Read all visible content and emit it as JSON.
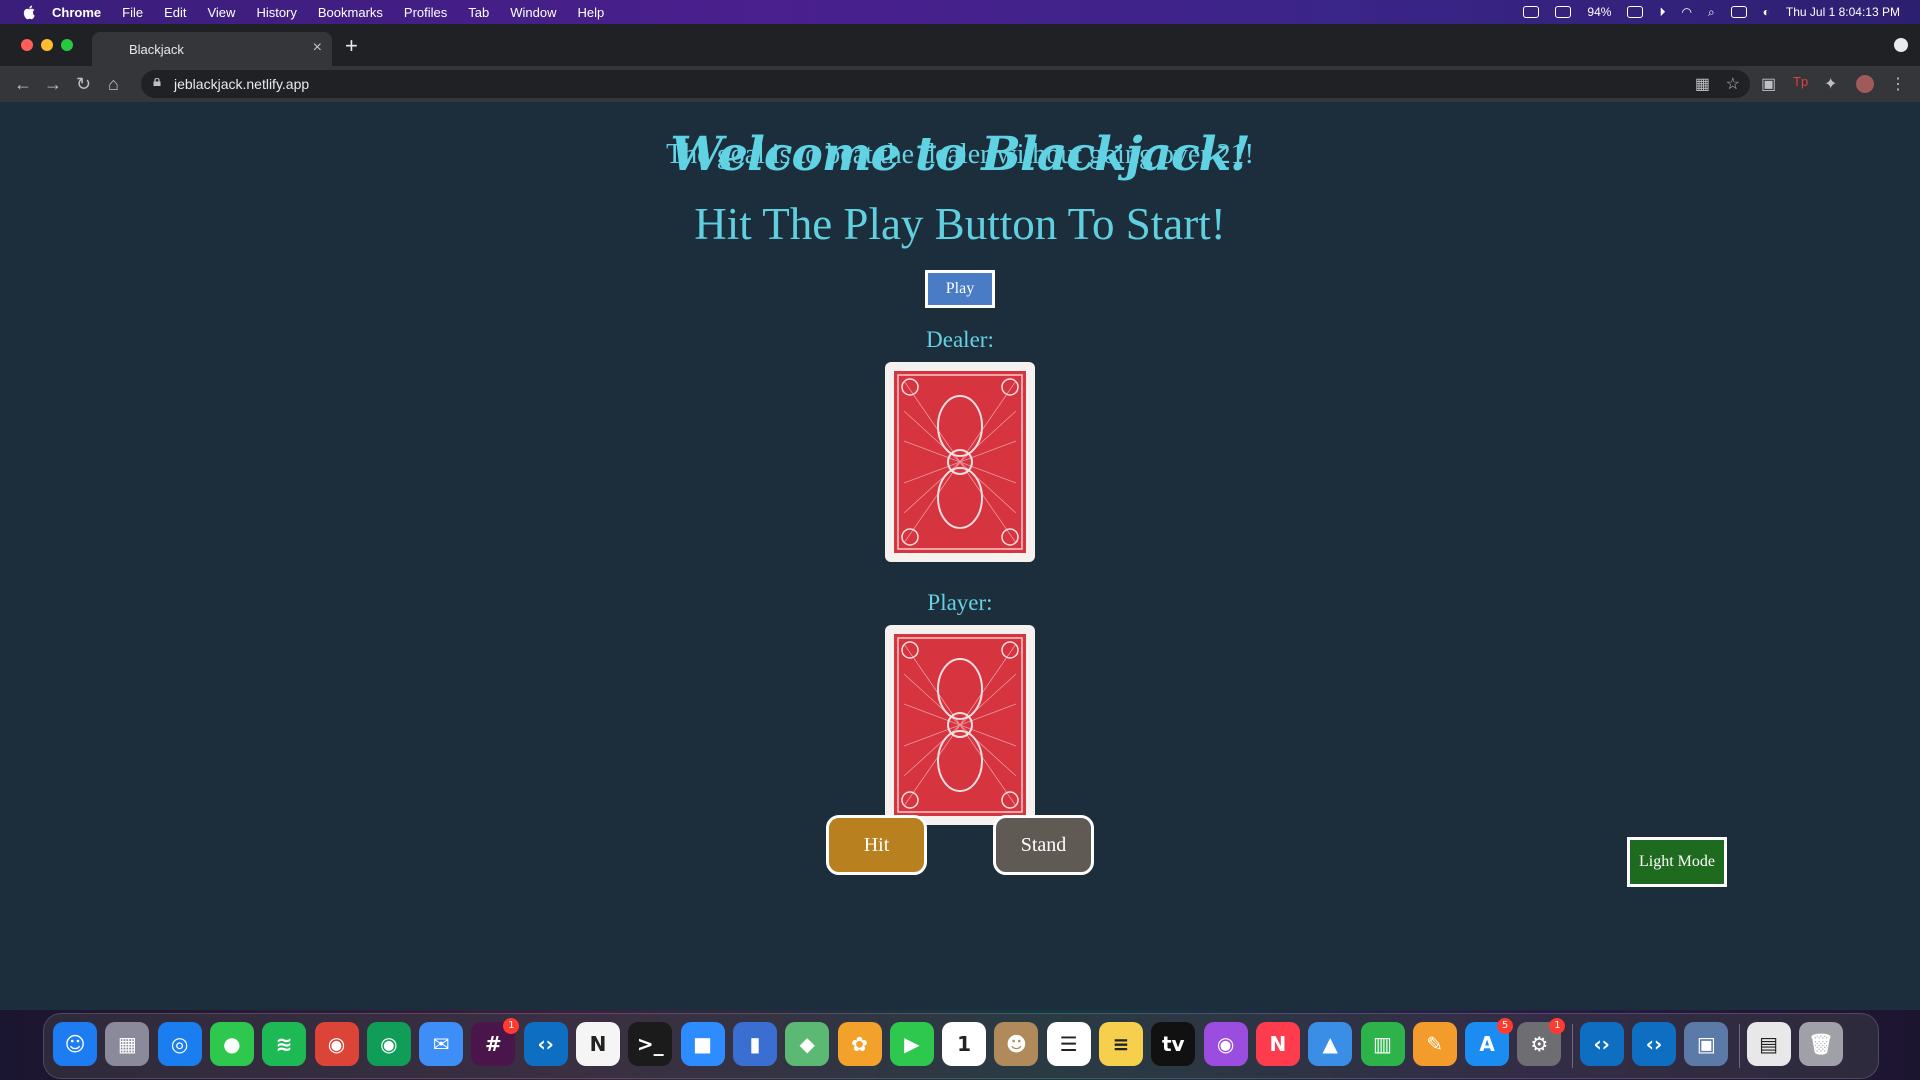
{
  "menubar": {
    "items": [
      "Chrome",
      "File",
      "Edit",
      "View",
      "History",
      "Bookmarks",
      "Profiles",
      "Tab",
      "Window",
      "Help"
    ],
    "battery": "94%",
    "datetime": "Thu Jul 1  8:04:13 PM"
  },
  "browser": {
    "tab_title": "Blackjack",
    "url": "jeblackjack.netlify.app"
  },
  "page": {
    "title": "Welcome to Blackjack!",
    "subtitle": "The goal is to beat the dealer without going over 21!",
    "instruction": "Hit The Play Button To Start!",
    "play_label": "Play",
    "dealer_label": "Dealer:",
    "player_label": "Player:",
    "hit_label": "Hit",
    "stand_label": "Stand",
    "light_mode_label": "Light Mode"
  },
  "colors": {
    "page_bg": "#1c2e3c",
    "heading": "#5fd3e3",
    "play_button": "#4a7cc6",
    "hit_button": "#b8801f",
    "stand_button": "#5f5a54",
    "light_mode_button": "#1e6b1f",
    "card_back": "#d6343f"
  },
  "dock": {
    "apps": [
      {
        "name": "finder-icon",
        "color": "#1e7cf2",
        "glyph": "☺"
      },
      {
        "name": "launchpad-icon",
        "color": "#8a8a9a",
        "glyph": "▦"
      },
      {
        "name": "safari-icon",
        "color": "#1b7ef0",
        "glyph": "◎"
      },
      {
        "name": "messages-icon",
        "color": "#2dc84d",
        "glyph": "●"
      },
      {
        "name": "spotify-icon",
        "color": "#1db954",
        "glyph": "≋"
      },
      {
        "name": "chrome-icon",
        "color": "#db4437",
        "glyph": "◉"
      },
      {
        "name": "chrome-alt-icon",
        "color": "#0f9d58",
        "glyph": "◉"
      },
      {
        "name": "mail-icon",
        "color": "#3d8ef7",
        "glyph": "✉"
      },
      {
        "name": "slack-icon",
        "color": "#4a154b",
        "glyph": "#",
        "badge": "1"
      },
      {
        "name": "vscode-icon",
        "color": "#0e6fc2",
        "glyph": "‹›"
      },
      {
        "name": "notion-icon",
        "color": "#f5f5f5",
        "glyph": "N",
        "dark": true
      },
      {
        "name": "terminal-icon",
        "color": "#1b1b1b",
        "glyph": ">_"
      },
      {
        "name": "zoom-icon",
        "color": "#2d8cff",
        "glyph": "■"
      },
      {
        "name": "books-icon",
        "color": "#3a6ed0",
        "glyph": "▮"
      },
      {
        "name": "maps-icon",
        "color": "#5bb974",
        "glyph": "◆"
      },
      {
        "name": "photos-icon",
        "color": "#f2a12b",
        "glyph": "✿"
      },
      {
        "name": "facetime-icon",
        "color": "#2dc84d",
        "glyph": "▶"
      },
      {
        "name": "calendar-icon",
        "color": "#ffffff",
        "glyph": "1",
        "dark": true
      },
      {
        "name": "contacts-icon",
        "color": "#b08a5a",
        "glyph": "☻"
      },
      {
        "name": "reminders-icon",
        "color": "#ffffff",
        "glyph": "☰",
        "dark": true
      },
      {
        "name": "notes-icon",
        "color": "#f6d04d",
        "glyph": "≡",
        "dark": true
      },
      {
        "name": "appletv-icon",
        "color": "#111111",
        "glyph": "tv"
      },
      {
        "name": "podcasts-icon",
        "color": "#9b4de0",
        "glyph": "◉"
      },
      {
        "name": "news-icon",
        "color": "#ff3b4e",
        "glyph": "N"
      },
      {
        "name": "keynote-icon",
        "color": "#3a8ee6",
        "glyph": "▲"
      },
      {
        "name": "numbers-icon",
        "color": "#2cb34a",
        "glyph": "▥"
      },
      {
        "name": "pages-icon",
        "color": "#f39c2b",
        "glyph": "✎"
      },
      {
        "name": "appstore-icon",
        "color": "#1a8cf2",
        "glyph": "A",
        "badge": "5"
      },
      {
        "name": "system-preferences-icon",
        "color": "#6d6d72",
        "glyph": "⚙",
        "badge": "1"
      },
      {
        "name": "vscode-2-icon",
        "color": "#0e6fc2",
        "glyph": "‹›"
      },
      {
        "name": "vscode-3-icon",
        "color": "#0e6fc2",
        "glyph": "‹›"
      },
      {
        "name": "preview-icon",
        "color": "#5b7aa8",
        "glyph": "▣"
      },
      {
        "name": "downloads-stack-icon",
        "color": "#e8e8e8",
        "glyph": "▤",
        "dark": true
      },
      {
        "name": "trash-icon",
        "color": "#a0a0a8",
        "glyph": "🗑"
      }
    ]
  }
}
